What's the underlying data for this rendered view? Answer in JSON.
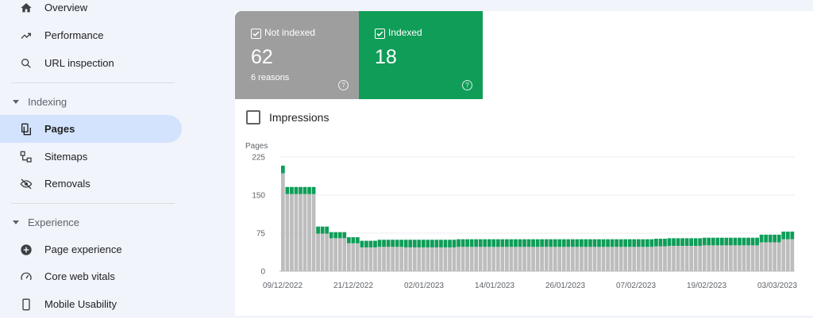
{
  "sidebar": {
    "items": [
      {
        "label": "Overview",
        "icon": "home-icon"
      },
      {
        "label": "Performance",
        "icon": "trending-up-icon"
      },
      {
        "label": "URL inspection",
        "icon": "search-icon"
      }
    ],
    "indexing": {
      "header": "Indexing",
      "items": [
        {
          "label": "Pages",
          "icon": "pages-icon",
          "active": true
        },
        {
          "label": "Sitemaps",
          "icon": "sitemap-icon"
        },
        {
          "label": "Removals",
          "icon": "visibility-off-icon"
        }
      ]
    },
    "experience": {
      "header": "Experience",
      "items": [
        {
          "label": "Page experience",
          "icon": "add-circle-icon"
        },
        {
          "label": "Core web vitals",
          "icon": "speedometer-icon"
        },
        {
          "label": "Mobile Usability",
          "icon": "phone-icon"
        }
      ]
    }
  },
  "cards": {
    "not_indexed": {
      "label": "Not indexed",
      "value": "62",
      "sub": "6 reasons",
      "color": "#9e9e9e"
    },
    "indexed": {
      "label": "Indexed",
      "value": "18",
      "color": "#0f9d58"
    }
  },
  "impressions_label": "Impressions",
  "chart_data": {
    "type": "bar",
    "stacked": true,
    "ylabel": "Pages",
    "ylim": [
      0,
      225
    ],
    "yticks": [
      "225",
      "150",
      "75",
      "0"
    ],
    "xtick_labels": [
      "09/12/2022",
      "21/12/2022",
      "02/01/2023",
      "14/01/2023",
      "26/01/2023",
      "07/02/2023",
      "19/02/2023",
      "03/03/2023"
    ],
    "grid": true,
    "series": [
      {
        "name": "Not indexed",
        "color": "#bdbdbd",
        "values": [
          193,
          152,
          152,
          152,
          152,
          152,
          152,
          152,
          74,
          74,
          74,
          65,
          65,
          65,
          65,
          55,
          55,
          55,
          47,
          47,
          47,
          47,
          48,
          48,
          48,
          48,
          48,
          48,
          47,
          47,
          47,
          47,
          47,
          47,
          47,
          47,
          47,
          47,
          47,
          47,
          48,
          48,
          48,
          48,
          48,
          48,
          48,
          48,
          48,
          48,
          48,
          48,
          48,
          48,
          48,
          48,
          48,
          48,
          48,
          48,
          48,
          48,
          48,
          48,
          48,
          48,
          48,
          48,
          48,
          48,
          48,
          48,
          48,
          48,
          48,
          48,
          48,
          48,
          48,
          48,
          48,
          48,
          48,
          48,
          48,
          49,
          49,
          49,
          50,
          50,
          50,
          50,
          50,
          50,
          50,
          50,
          51,
          51,
          51,
          51,
          51,
          51,
          51,
          51,
          51,
          51,
          51,
          51,
          51,
          57,
          57,
          57,
          57,
          57,
          63,
          63,
          63
        ]
      },
      {
        "name": "Indexed",
        "color": "#0f9d58",
        "values": [
          15,
          14,
          14,
          14,
          14,
          14,
          14,
          14,
          14,
          14,
          14,
          12,
          12,
          12,
          12,
          12,
          12,
          12,
          13,
          13,
          13,
          13,
          14,
          14,
          14,
          14,
          14,
          14,
          15,
          15,
          15,
          15,
          15,
          15,
          15,
          15,
          15,
          15,
          15,
          15,
          15,
          15,
          15,
          15,
          15,
          15,
          15,
          15,
          15,
          15,
          15,
          15,
          15,
          15,
          15,
          15,
          15,
          15,
          15,
          15,
          15,
          15,
          15,
          15,
          15,
          15,
          15,
          15,
          15,
          15,
          15,
          15,
          15,
          15,
          15,
          15,
          15,
          15,
          15,
          15,
          15,
          15,
          15,
          15,
          15,
          15,
          15,
          15,
          15,
          15,
          15,
          15,
          15,
          15,
          15,
          15,
          15,
          15,
          15,
          15,
          15,
          15,
          15,
          15,
          15,
          15,
          15,
          15,
          15,
          15,
          15,
          15,
          15,
          15,
          15,
          15,
          15
        ]
      }
    ]
  }
}
